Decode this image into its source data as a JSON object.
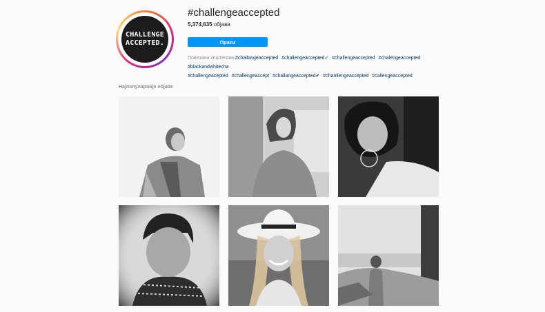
{
  "header": {
    "avatar_text_line1": "CHALLENGE",
    "avatar_text_line2": "ACCEPTED.",
    "hashtag": "#challengeaccepted",
    "post_count": "5,374,635",
    "post_word": "објава",
    "follow_label": "Прати"
  },
  "related": {
    "label": "Повезани хештегови",
    "tags": [
      "#challangeaccepted",
      "#challengeaccepted✓",
      "#challengeaccepted",
      "#chalengeaccepted",
      "#blackandwhitecha",
      "#challengeacepted",
      "#challengeaccept",
      "#challangeaccepted✔",
      "#chanllengeaccepted",
      "#callengeaccepted"
    ]
  },
  "section": {
    "title": "Најпопуларније објаве"
  },
  "posts": [
    {
      "alt": "woman in jacket smiling"
    },
    {
      "alt": "woman with bob haircut in sweater"
    },
    {
      "alt": "woman lying with hoop earrings"
    },
    {
      "alt": "smiling woman with scarf"
    },
    {
      "alt": "smiling woman in white hat"
    },
    {
      "alt": "person on rocks by the sea"
    }
  ]
}
